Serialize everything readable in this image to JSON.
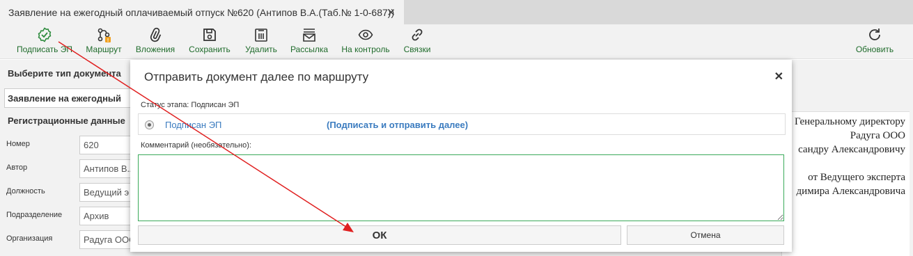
{
  "tab": {
    "title": "Заявление на ежегодный оплачиваемый отпуск №620 (Антипов В.А.(Таб.№ 1-0-687))",
    "close_glyph": "✕"
  },
  "toolbar": {
    "sign_label": "Подписать ЭП",
    "route_label": "Маршрут",
    "attachments_label": "Вложения",
    "save_label": "Сохранить",
    "delete_label": "Удалить",
    "mailing_label": "Рассылка",
    "control_label": "На контроль",
    "links_label": "Связки",
    "refresh_label": "Обновить",
    "icons": [
      "badge-check-icon",
      "route-icon",
      "paperclip-icon",
      "floppy-icon",
      "trash-icon",
      "mail-icon",
      "eye-icon",
      "link-icon",
      "refresh-icon"
    ],
    "accent_color": "#1f6b2b"
  },
  "form": {
    "doc_type_heading": "Выберите тип документа",
    "doc_type_value": "Заявление на ежегодный",
    "reg_heading": "Регистрационные данные",
    "fields": [
      {
        "label": "Номер",
        "value": "620"
      },
      {
        "label": "Автор",
        "value": "Антипов В.А."
      },
      {
        "label": "Должность",
        "value": "Ведущий э"
      },
      {
        "label": "Подразделение",
        "value": "Архив"
      },
      {
        "label": "Организация",
        "value": "Радуга ООО"
      }
    ]
  },
  "document_preview": {
    "lines": [
      "Генеральному директору",
      "Радуга ООО",
      "сандру Александровичу",
      "от Ведущего эксперта",
      "димира Александровича"
    ]
  },
  "modal": {
    "title": "Отправить документ далее по маршруту",
    "close_glyph": "✕",
    "status_label": "Статус этапа: Подписан ЭП",
    "option_label": "Подписан ЭП",
    "option_action": "(Подписать и отправить далее)",
    "comment_label": "Комментарий (необязательно):",
    "comment_value": "",
    "ok_label": "ОК",
    "cancel_label": "Отмена",
    "link_color": "#3a7bbf",
    "focus_color": "#3aaa5a"
  },
  "annotation": {
    "arrow_color": "#e02020"
  }
}
